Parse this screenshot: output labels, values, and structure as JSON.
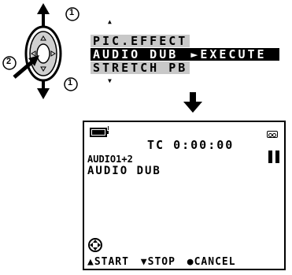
{
  "dial": {
    "step1_label": "1",
    "step2_label": "2"
  },
  "menu": {
    "items": [
      {
        "label": "PIC.EFFECT",
        "state": "dim"
      },
      {
        "label": "AUDIO DUB",
        "state": "selected",
        "action": "►EXECUTE"
      },
      {
        "label": "STRETCH PB",
        "state": "dim"
      }
    ]
  },
  "screen": {
    "timecode": "TC 0:00:00",
    "audio_mode": "AUDIO1+2",
    "status": "AUDIO DUB",
    "controls": {
      "start": "▲START",
      "stop": "▼STOP",
      "cancel": "●CANCEL"
    }
  },
  "colors": {
    "selected_bg": "#000000",
    "dim_bg": "#c8c8c8"
  }
}
